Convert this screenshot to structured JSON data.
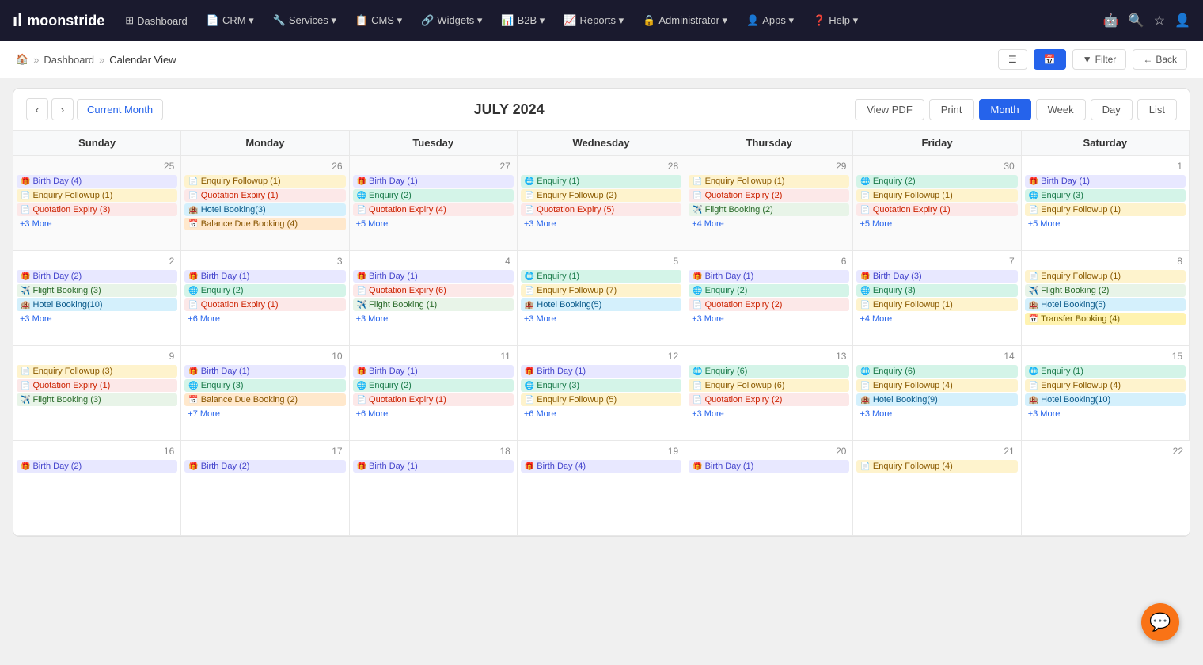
{
  "brand": "moonstride",
  "nav": {
    "items": [
      {
        "label": "Dashboard",
        "icon": "⊞"
      },
      {
        "label": "CRM ▾",
        "icon": "📄"
      },
      {
        "label": "Services ▾",
        "icon": "🔧"
      },
      {
        "label": "CMS ▾",
        "icon": "📋"
      },
      {
        "label": "Widgets ▾",
        "icon": "🔗"
      },
      {
        "label": "B2B ▾",
        "icon": "📊"
      },
      {
        "label": "Reports ▾",
        "icon": "📈"
      },
      {
        "label": "Administrator ▾",
        "icon": "🔒"
      },
      {
        "label": "Apps ▾",
        "icon": "👤"
      },
      {
        "label": "Help ▾",
        "icon": "❓"
      }
    ]
  },
  "breadcrumb": {
    "home": "🏠",
    "parent": "Dashboard",
    "current": "Calendar View"
  },
  "toolbar": {
    "list_icon": "☰",
    "calendar_icon": "📅",
    "filter_label": "Filter",
    "back_label": "Back"
  },
  "calendar": {
    "title": "JULY 2024",
    "current_month_label": "Current Month",
    "view_pdf_label": "View PDF",
    "print_label": "Print",
    "month_label": "Month",
    "week_label": "Week",
    "day_label": "Day",
    "list_label": "List",
    "day_headers": [
      "Sunday",
      "Monday",
      "Tuesday",
      "Wednesday",
      "Thursday",
      "Friday",
      "Saturday"
    ],
    "weeks": [
      {
        "days": [
          {
            "num": "25",
            "other": true,
            "events": [
              {
                "type": "birthday",
                "label": "Birth Day (4)"
              },
              {
                "type": "enquiry-followup",
                "label": "Enquiry Followup (1)"
              },
              {
                "type": "quotation-expiry",
                "label": "Quotation Expiry (3)"
              }
            ],
            "more": "+3 More"
          },
          {
            "num": "26",
            "other": true,
            "events": [
              {
                "type": "enquiry-followup",
                "label": "Enquiry Followup (1)"
              },
              {
                "type": "quotation-expiry",
                "label": "Quotation Expiry (1)"
              },
              {
                "type": "hotel-booking",
                "label": "Hotel Booking(3)"
              },
              {
                "type": "balance-due",
                "label": "Balance Due Booking (4)"
              }
            ],
            "more": null
          },
          {
            "num": "27",
            "other": true,
            "events": [
              {
                "type": "birthday",
                "label": "Birth Day (1)"
              },
              {
                "type": "enquiry",
                "label": "Enquiry (2)"
              },
              {
                "type": "quotation-expiry",
                "label": "Quotation Expiry (4)"
              }
            ],
            "more": "+5 More"
          },
          {
            "num": "28",
            "other": true,
            "events": [
              {
                "type": "enquiry",
                "label": "Enquiry (1)"
              },
              {
                "type": "enquiry-followup",
                "label": "Enquiry Followup (2)"
              },
              {
                "type": "quotation-expiry",
                "label": "Quotation Expiry (5)"
              }
            ],
            "more": "+3 More"
          },
          {
            "num": "29",
            "other": true,
            "events": [
              {
                "type": "enquiry-followup",
                "label": "Enquiry Followup (1)"
              },
              {
                "type": "quotation-expiry",
                "label": "Quotation Expiry (2)"
              },
              {
                "type": "flight-booking",
                "label": "Flight Booking (2)"
              }
            ],
            "more": "+4 More"
          },
          {
            "num": "30",
            "other": true,
            "events": [
              {
                "type": "enquiry",
                "label": "Enquiry (2)"
              },
              {
                "type": "enquiry-followup",
                "label": "Enquiry Followup (1)"
              },
              {
                "type": "quotation-expiry",
                "label": "Quotation Expiry (1)"
              }
            ],
            "more": "+5 More"
          },
          {
            "num": "1",
            "other": false,
            "events": [
              {
                "type": "birthday",
                "label": "Birth Day (1)"
              },
              {
                "type": "enquiry",
                "label": "Enquiry (3)"
              },
              {
                "type": "enquiry-followup",
                "label": "Enquiry Followup (1)"
              }
            ],
            "more": "+5 More"
          }
        ]
      },
      {
        "days": [
          {
            "num": "2",
            "other": false,
            "events": [
              {
                "type": "birthday",
                "label": "Birth Day (2)"
              },
              {
                "type": "flight-booking",
                "label": "Flight Booking (3)"
              },
              {
                "type": "hotel-booking",
                "label": "Hotel Booking(10)"
              }
            ],
            "more": "+3 More"
          },
          {
            "num": "3",
            "other": false,
            "events": [
              {
                "type": "birthday",
                "label": "Birth Day (1)"
              },
              {
                "type": "enquiry",
                "label": "Enquiry (2)"
              },
              {
                "type": "quotation-expiry",
                "label": "Quotation Expiry (1)"
              }
            ],
            "more": "+6 More"
          },
          {
            "num": "4",
            "other": false,
            "events": [
              {
                "type": "birthday",
                "label": "Birth Day (1)"
              },
              {
                "type": "quotation-expiry",
                "label": "Quotation Expiry (6)"
              },
              {
                "type": "flight-booking",
                "label": "Flight Booking (1)"
              }
            ],
            "more": "+3 More"
          },
          {
            "num": "5",
            "other": false,
            "events": [
              {
                "type": "enquiry",
                "label": "Enquiry (1)"
              },
              {
                "type": "enquiry-followup",
                "label": "Enquiry Followup (7)"
              },
              {
                "type": "hotel-booking",
                "label": "Hotel Booking(5)"
              }
            ],
            "more": "+3 More"
          },
          {
            "num": "6",
            "other": false,
            "events": [
              {
                "type": "birthday",
                "label": "Birth Day (1)"
              },
              {
                "type": "enquiry",
                "label": "Enquiry (2)"
              },
              {
                "type": "quotation-expiry",
                "label": "Quotation Expiry (2)"
              }
            ],
            "more": "+3 More"
          },
          {
            "num": "7",
            "other": false,
            "events": [
              {
                "type": "birthday",
                "label": "Birth Day (3)"
              },
              {
                "type": "enquiry",
                "label": "Enquiry (3)"
              },
              {
                "type": "enquiry-followup",
                "label": "Enquiry Followup (1)"
              }
            ],
            "more": "+4 More"
          },
          {
            "num": "8",
            "other": false,
            "events": [
              {
                "type": "enquiry-followup",
                "label": "Enquiry Followup (1)"
              },
              {
                "type": "flight-booking",
                "label": "Flight Booking (2)"
              },
              {
                "type": "hotel-booking",
                "label": "Hotel Booking(5)"
              },
              {
                "type": "transfer",
                "label": "Transfer Booking (4)"
              }
            ],
            "more": null
          }
        ]
      },
      {
        "days": [
          {
            "num": "9",
            "other": false,
            "events": [
              {
                "type": "enquiry-followup",
                "label": "Enquiry Followup (3)"
              },
              {
                "type": "quotation-expiry",
                "label": "Quotation Expiry (1)"
              },
              {
                "type": "flight-booking",
                "label": "Flight Booking (3)"
              }
            ],
            "more": null
          },
          {
            "num": "10",
            "other": false,
            "events": [
              {
                "type": "birthday",
                "label": "Birth Day (1)"
              },
              {
                "type": "enquiry",
                "label": "Enquiry (3)"
              },
              {
                "type": "balance-due",
                "label": "Balance Due Booking (2)"
              }
            ],
            "more": "+7 More"
          },
          {
            "num": "11",
            "other": false,
            "events": [
              {
                "type": "birthday",
                "label": "Birth Day (1)"
              },
              {
                "type": "enquiry",
                "label": "Enquiry (2)"
              },
              {
                "type": "quotation-expiry",
                "label": "Quotation Expiry (1)"
              }
            ],
            "more": "+6 More"
          },
          {
            "num": "12",
            "other": false,
            "events": [
              {
                "type": "birthday",
                "label": "Birth Day (1)"
              },
              {
                "type": "enquiry",
                "label": "Enquiry (3)"
              },
              {
                "type": "enquiry-followup",
                "label": "Enquiry Followup (5)"
              }
            ],
            "more": "+6 More"
          },
          {
            "num": "13",
            "other": false,
            "events": [
              {
                "type": "enquiry",
                "label": "Enquiry (6)"
              },
              {
                "type": "enquiry-followup",
                "label": "Enquiry Followup (6)"
              },
              {
                "type": "quotation-expiry",
                "label": "Quotation Expiry (2)"
              }
            ],
            "more": "+3 More"
          },
          {
            "num": "14",
            "other": false,
            "events": [
              {
                "type": "enquiry",
                "label": "Enquiry (6)"
              },
              {
                "type": "enquiry-followup",
                "label": "Enquiry Followup (4)"
              },
              {
                "type": "hotel-booking",
                "label": "Hotel Booking(9)"
              }
            ],
            "more": "+3 More"
          },
          {
            "num": "15",
            "other": false,
            "events": [
              {
                "type": "enquiry",
                "label": "Enquiry (1)"
              },
              {
                "type": "enquiry-followup",
                "label": "Enquiry Followup (4)"
              },
              {
                "type": "hotel-booking",
                "label": "Hotel Booking(10)"
              }
            ],
            "more": "+3 More"
          }
        ]
      },
      {
        "days": [
          {
            "num": "16",
            "other": false,
            "events": [
              {
                "type": "birthday",
                "label": "Birth Day (2)"
              }
            ],
            "more": null
          },
          {
            "num": "17",
            "other": false,
            "events": [
              {
                "type": "birthday",
                "label": "Birth Day (2)"
              }
            ],
            "more": null
          },
          {
            "num": "18",
            "other": false,
            "events": [
              {
                "type": "birthday",
                "label": "Birth Day (1)"
              }
            ],
            "more": null
          },
          {
            "num": "19",
            "other": false,
            "events": [
              {
                "type": "birthday",
                "label": "Birth Day (4)"
              }
            ],
            "more": null
          },
          {
            "num": "20",
            "other": false,
            "events": [
              {
                "type": "birthday",
                "label": "Birth Day (1)"
              }
            ],
            "more": null
          },
          {
            "num": "21",
            "other": false,
            "events": [
              {
                "type": "enquiry-followup",
                "label": "Enquiry Followup (4)"
              }
            ],
            "more": null
          },
          {
            "num": "22",
            "other": false,
            "events": [],
            "more": null
          }
        ]
      }
    ]
  }
}
